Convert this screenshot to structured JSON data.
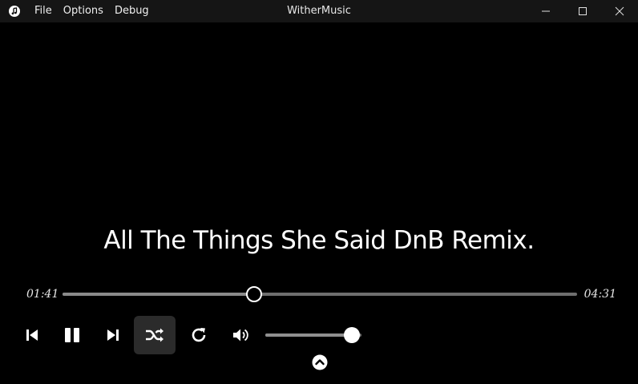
{
  "window": {
    "title": "WitherMusic",
    "app_icon": "music-note-icon",
    "controls": [
      "minimize-icon",
      "maximize-icon",
      "close-icon"
    ]
  },
  "menu": {
    "items": [
      {
        "label": "File"
      },
      {
        "label": "Options"
      },
      {
        "label": "Debug"
      }
    ]
  },
  "player": {
    "song_title": "All The Things She Said DnB Remix.",
    "current_time": "01:41",
    "total_time": "04:31",
    "progress": 0.37,
    "volume": 0.9,
    "shuffle_active": true,
    "icons": {
      "previous": "skip-previous-icon",
      "pause": "pause-icon",
      "next": "skip-next-icon",
      "shuffle": "shuffle-icon",
      "repeat": "repeat-icon",
      "volume": "volume-icon",
      "expand": "chevron-up-circle-icon"
    }
  },
  "colors": {
    "background": "#000000",
    "titlebar": "#151515",
    "track": "#6e6e6e",
    "active_button": "#2b2b2b",
    "text": "#ffffff"
  }
}
